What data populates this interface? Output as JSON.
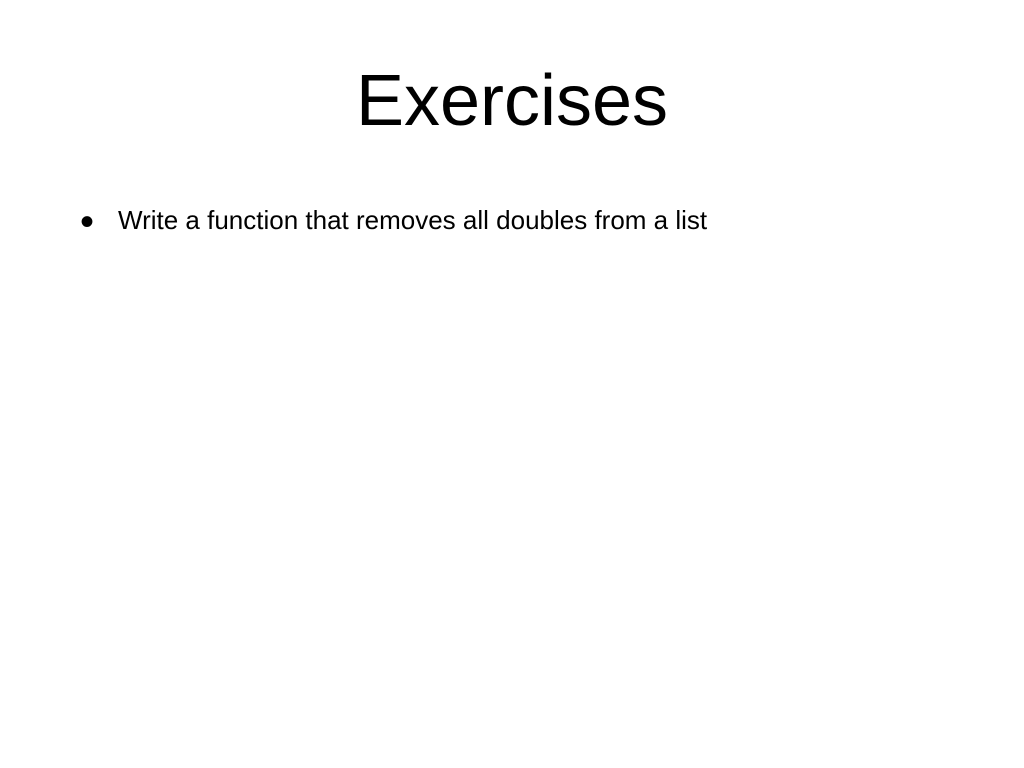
{
  "slide": {
    "title": "Exercises",
    "bullets": [
      {
        "text": "Write a function that removes all doubles from a list"
      }
    ]
  }
}
